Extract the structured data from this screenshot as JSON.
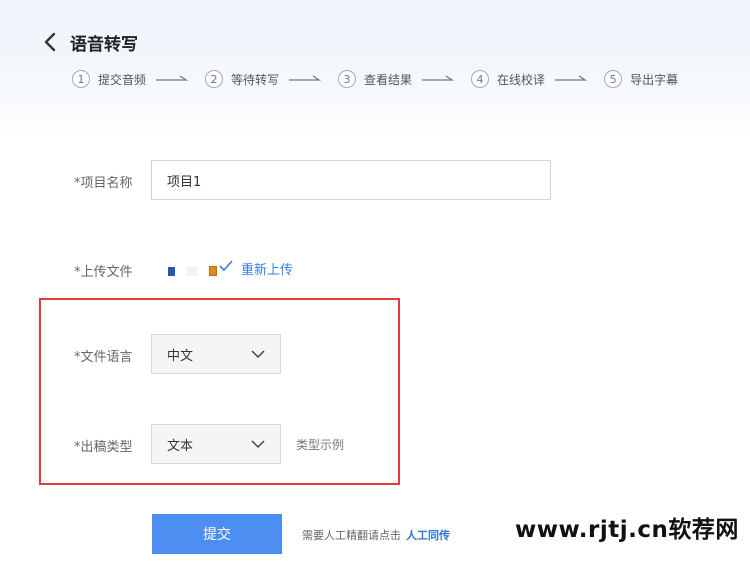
{
  "header": {
    "title": "语音转写",
    "back_icon": "chevron-left-icon"
  },
  "steps": [
    {
      "num": "1",
      "label": "提交音频"
    },
    {
      "num": "2",
      "label": "等待转写"
    },
    {
      "num": "3",
      "label": "查看结果"
    },
    {
      "num": "4",
      "label": "在线校译"
    },
    {
      "num": "5",
      "label": "导出字幕"
    }
  ],
  "form": {
    "project_name": {
      "label": "*项目名称",
      "value": "项目1"
    },
    "upload": {
      "label": "*上传文件",
      "reupload_label": "重新上传"
    },
    "language": {
      "label": "*文件语言",
      "value": "中文"
    },
    "output_type": {
      "label": "*出稿类型",
      "value": "文本",
      "example_label": "类型示例"
    }
  },
  "actions": {
    "submit_label": "提交",
    "human_hint": "需要人工精翻请点击",
    "human_link": "人工同传"
  },
  "watermark": "www.rjtj.cn软荐网",
  "colors": {
    "accent": "#4d8ef2",
    "link": "#3a7ee4",
    "highlight": "#e5393b"
  }
}
